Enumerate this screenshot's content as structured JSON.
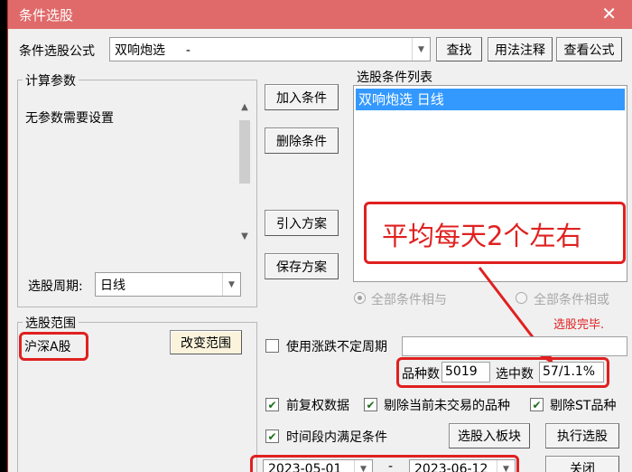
{
  "window": {
    "title": "条件选股",
    "close_glyph": "✕"
  },
  "formula": {
    "label": "条件选股公式",
    "value": "双响炮选 　 -"
  },
  "top_buttons": {
    "find": "查找",
    "usage": "用法注释",
    "view_formula": "查看公式"
  },
  "calc_params": {
    "title": "计算参数",
    "message": "无参数需要设置"
  },
  "period": {
    "label": "选股周期:",
    "value": "日线"
  },
  "middle_buttons": {
    "add": "加入条件",
    "delete": "删除条件",
    "import": "引入方案",
    "save": "保存方案"
  },
  "condition_list": {
    "title": "选股条件列表",
    "items": [
      "双响炮选  日线"
    ]
  },
  "annotation": {
    "text": "平均每天2个左右"
  },
  "logic": {
    "all_and": "全部条件相与",
    "all_or": "全部条件相或"
  },
  "status": {
    "done": "选股完毕."
  },
  "scope": {
    "title": "选股范围",
    "value": "沪深A股",
    "change_button": "改变范围"
  },
  "options": {
    "use_limit_period": "使用涨跌不定周期",
    "pre_adjust": "前复权数据",
    "exclude_no_trade": "剔除当前未交易的品种",
    "exclude_st": "剔除ST品种",
    "time_range": "时间段内满足条件"
  },
  "counts": {
    "varieties_label": "品种数",
    "varieties_value": "5019",
    "selected_label": "选中数",
    "selected_value": "57/1.1%"
  },
  "bottom_buttons": {
    "to_block": "选股入板块",
    "execute": "执行选股",
    "close": "关闭"
  },
  "dates": {
    "start": "2023-05-01",
    "separator": "-",
    "end": "2023-06-12"
  },
  "colors": {
    "titlebar": "#e06a6a",
    "selection": "#3399ff",
    "annotation": "#e02020"
  }
}
